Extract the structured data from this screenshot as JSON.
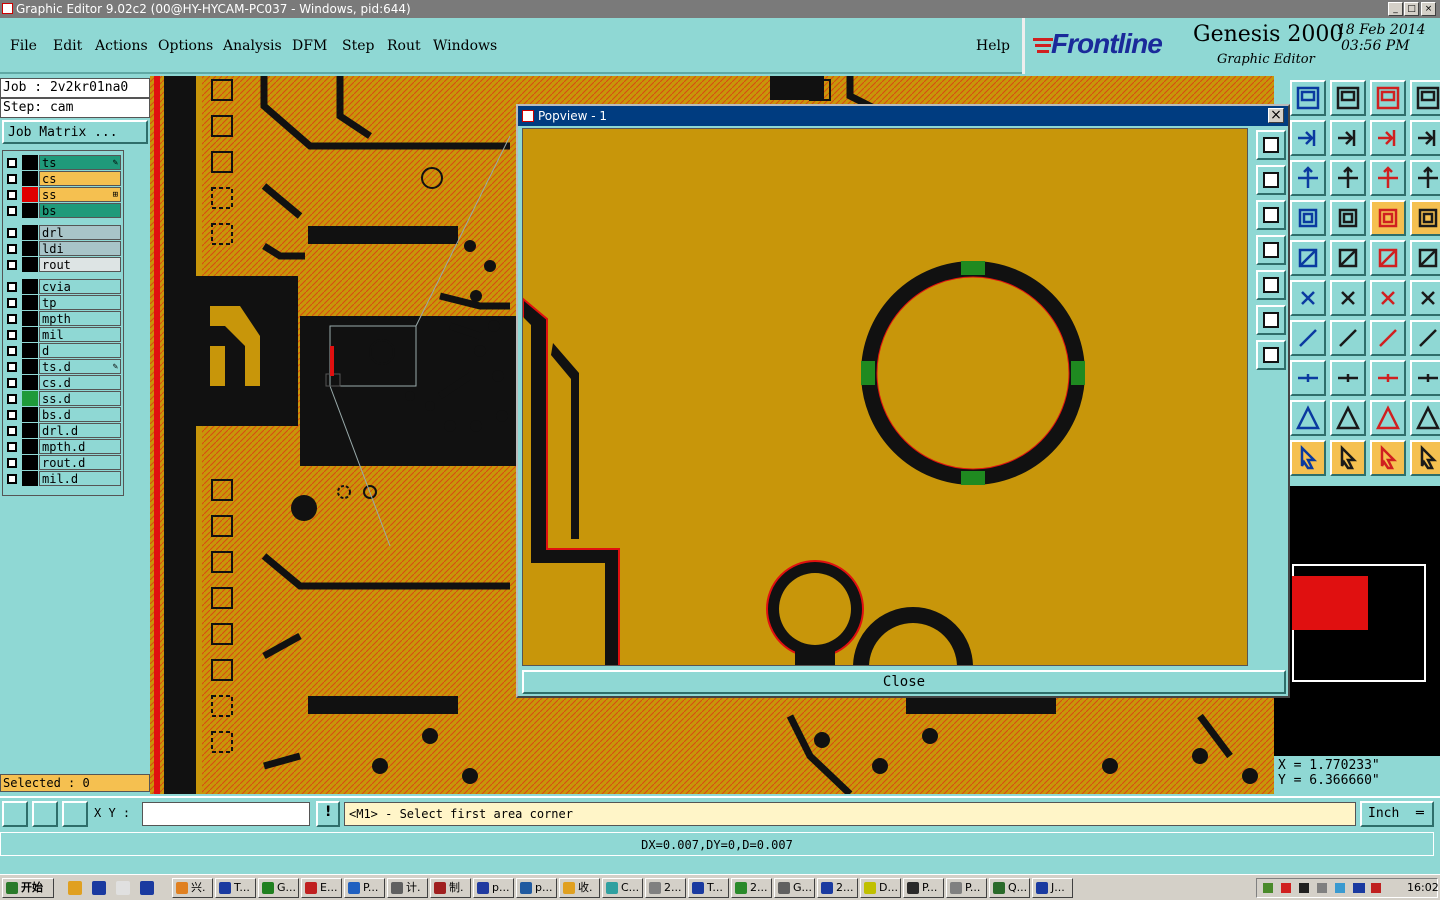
{
  "window": {
    "title": "Graphic Editor 9.02c2 (00@HY-HYCAM-PC037 - Windows, pid:644)"
  },
  "menu": [
    "File",
    "Edit",
    "Actions",
    "Options",
    "Analysis",
    "DFM",
    "Step",
    "Rout",
    "Windows"
  ],
  "help": "Help",
  "brand": {
    "logo": "Frontline",
    "product": "Genesis 2000",
    "subtitle": "Graphic Editor",
    "date": "18 Feb 2014",
    "time": "03:56 PM"
  },
  "job": {
    "job_label": "Job : 2v2kr01na0",
    "step_label": "Step: cam",
    "matrix_button": "Job Matrix ..."
  },
  "layers": [
    {
      "name": "ts",
      "color": "#1f9a7a",
      "active_color": "#000000",
      "mark": "✎"
    },
    {
      "name": "cs",
      "color": "#f5c050",
      "active_color": "#000000",
      "mark": ""
    },
    {
      "name": "ss",
      "color": "#f5c050",
      "active_color": "#e00000",
      "mark": "⊞"
    },
    {
      "name": "bs",
      "color": "#1f9a7a",
      "active_color": "#000000",
      "mark": ""
    },
    {
      "name": "drl",
      "color": "#a8c4c8",
      "active_color": "#000000",
      "mark": ""
    },
    {
      "name": "ldi",
      "color": "#a8c4c8",
      "active_color": "#000000",
      "mark": ""
    },
    {
      "name": "rout",
      "color": "#dde4e4",
      "active_color": "#000000",
      "mark": ""
    },
    {
      "name": "cvia",
      "color": "#8fd8d4",
      "active_color": "#000000",
      "mark": ""
    },
    {
      "name": "tp",
      "color": "#8fd8d4",
      "active_color": "#000000",
      "mark": ""
    },
    {
      "name": "mpth",
      "color": "#8fd8d4",
      "active_color": "#000000",
      "mark": ""
    },
    {
      "name": "mil",
      "color": "#8fd8d4",
      "active_color": "#000000",
      "mark": ""
    },
    {
      "name": "d",
      "color": "#8fd8d4",
      "active_color": "#000000",
      "mark": ""
    },
    {
      "name": "ts.d",
      "color": "#8fd8d4",
      "active_color": "#000000",
      "mark": "✎"
    },
    {
      "name": "cs.d",
      "color": "#8fd8d4",
      "active_color": "#000000",
      "mark": ""
    },
    {
      "name": "ss.d",
      "color": "#8fd8d4",
      "active_color": "#1f9a3a",
      "mark": ""
    },
    {
      "name": "bs.d",
      "color": "#8fd8d4",
      "active_color": "#000000",
      "mark": ""
    },
    {
      "name": "drl.d",
      "color": "#8fd8d4",
      "active_color": "#000000",
      "mark": ""
    },
    {
      "name": "mpth.d",
      "color": "#8fd8d4",
      "active_color": "#000000",
      "mark": ""
    },
    {
      "name": "rout.d",
      "color": "#8fd8d4",
      "active_color": "#000000",
      "mark": ""
    },
    {
      "name": "mil.d",
      "color": "#8fd8d4",
      "active_color": "#000000",
      "mark": ""
    }
  ],
  "selected": "Selected : 0",
  "popview": {
    "title": "Popview - 1",
    "close_label": "Close",
    "close_x": "×"
  },
  "coords": {
    "x": "X = 1.770233\"",
    "y": "Y = 6.366660\""
  },
  "xy_label": "X Y :",
  "xy_value": "",
  "prompt": "<M1> - Select first area corner",
  "unit": "Inch",
  "dx_line": "DX=0.007,DY=0,D=0.007",
  "taskbar": {
    "start": "开始",
    "items": [
      "兴.",
      "T...",
      "G...",
      "E...",
      "P...",
      "计.",
      "制.",
      "p...",
      "p...",
      "收.",
      "C...",
      "2...",
      "T...",
      "2...",
      "G...",
      "2...",
      "D...",
      "P...",
      "P...",
      "Q...",
      "J..."
    ],
    "clock": "16:02"
  },
  "colors": {
    "copper": "#c8960a",
    "panel": "#8fd8d4",
    "title_blue": "#003c80"
  }
}
